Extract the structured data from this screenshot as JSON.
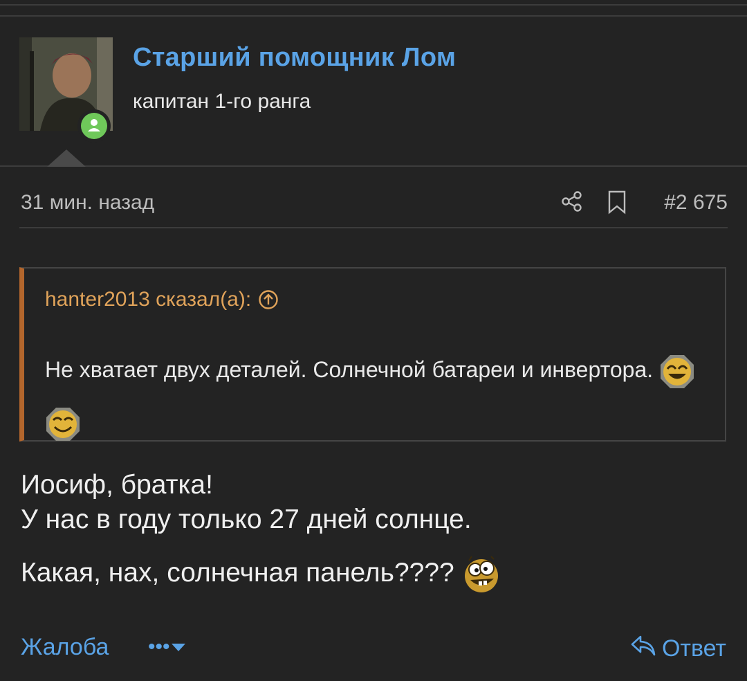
{
  "user": {
    "name": "Старший помощник Лом",
    "title": "капитан 1-го ранга",
    "online_color": "#6fc85a"
  },
  "post": {
    "time_ago": "31 мин. назад",
    "number": "#2 675",
    "share_icon": "share-icon",
    "bookmark_icon": "bookmark-icon"
  },
  "quote": {
    "author_line": "hanter2013 сказал(а):",
    "text": "Не хватает двух деталей. Солнечной батареи и инвертора.",
    "smileys": [
      "laughing-smiley-icon",
      "laughing-smiley-icon"
    ]
  },
  "message": {
    "line1": "Иосиф, братка!",
    "line2": "У нас в году только 27 дней солнце.",
    "line3": "Какая, нах, солнечная панель????"
  },
  "actions": {
    "report": "Жалоба",
    "more": "•••",
    "reply": "Ответ"
  },
  "colors": {
    "background": "#232323",
    "link": "#5aa3e6",
    "quote_accent": "#b3662c",
    "quote_author": "#e0a35a"
  }
}
